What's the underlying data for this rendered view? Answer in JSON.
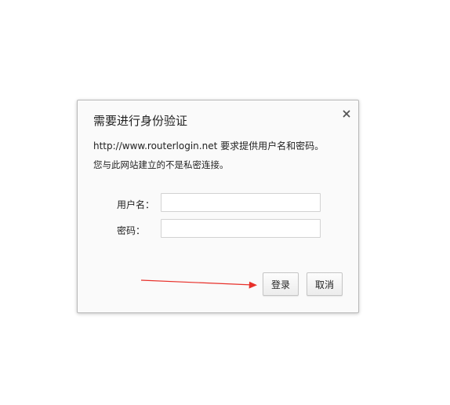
{
  "dialog": {
    "title": "需要进行身份验证",
    "message_line1": "http://www.routerlogin.net 要求提供用户名和密码。",
    "message_line2": "您与此网站建立的不是私密连接。",
    "username_label": "用户名：",
    "username_value": "",
    "password_label": "密码：",
    "password_value": "",
    "login_button": "登录",
    "cancel_button": "取消",
    "close_icon": "close-icon"
  },
  "annotation": {
    "arrow_color": "#e8302a",
    "points_to": "login-button"
  }
}
